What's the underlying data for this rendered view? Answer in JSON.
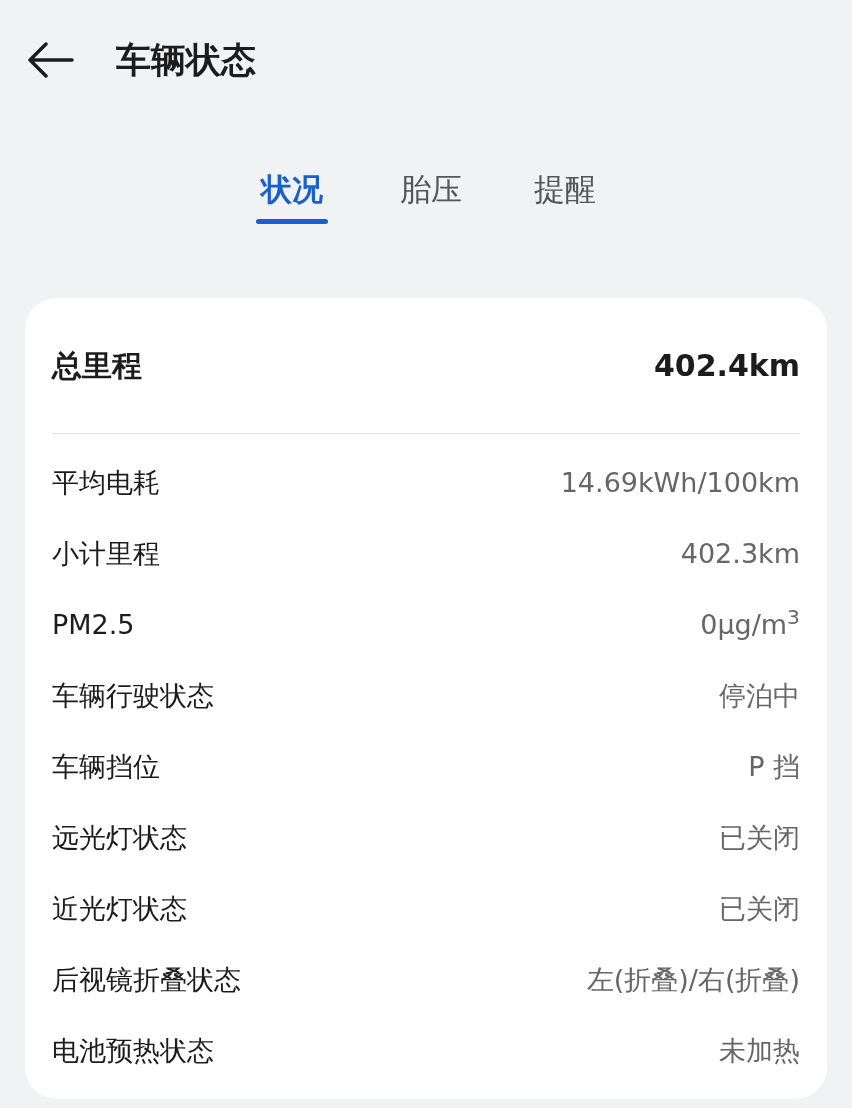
{
  "header": {
    "title": "车辆状态"
  },
  "tabs": [
    {
      "label": "状况",
      "selected": true
    },
    {
      "label": "胎压",
      "selected": false
    },
    {
      "label": "提醒",
      "selected": false
    }
  ],
  "summary": {
    "label": "总里程",
    "value": "402.4km"
  },
  "rows": [
    {
      "label": "平均电耗",
      "value": "14.69kWh/100km"
    },
    {
      "label": "小计里程",
      "value": "402.3km"
    },
    {
      "label": "PM2.5",
      "value": "0μg/m$^{3}$"
    },
    {
      "label": "车辆行驶状态",
      "value": "停泊中"
    },
    {
      "label": "车辆挡位",
      "value": "P 挡"
    },
    {
      "label": "远光灯状态",
      "value": "已关闭"
    },
    {
      "label": "近光灯状态",
      "value": "已关闭"
    },
    {
      "label": "后视镜折叠状态",
      "value": "左(折叠)/右(折叠)"
    },
    {
      "label": "电池预热状态",
      "value": "未加热"
    }
  ]
}
